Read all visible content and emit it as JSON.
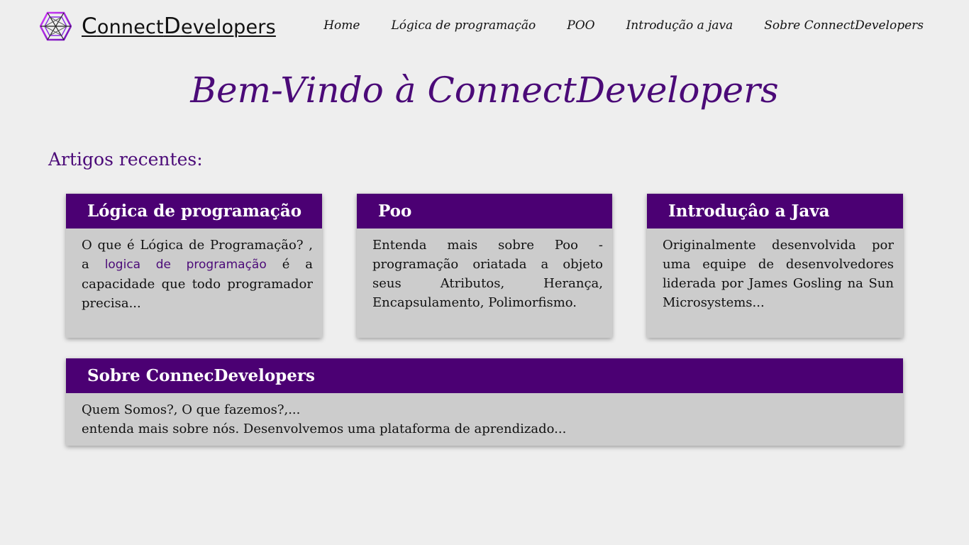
{
  "header": {
    "brand": {
      "c1": "C",
      "r1": "onnect",
      "c2": "D",
      "r2": "evelopers"
    },
    "nav": [
      {
        "label": "Home"
      },
      {
        "label": "Lógica de programação"
      },
      {
        "label": "POO"
      },
      {
        "label": "Introdução a java"
      },
      {
        "label": "Sobre ConnectDevelopers"
      }
    ]
  },
  "hero": {
    "title": "Bem-Vindo à ConnectDevelopers"
  },
  "recent": {
    "title": "Artigos recentes:",
    "cards": [
      {
        "title": "Lógica de programação",
        "before": "O que é Lógica de Programação? , a ",
        "link": "logica de programação",
        "after": " é a capacidade que todo programador precisa..."
      },
      {
        "title": "Poo",
        "body": "Entenda mais sobre Poo - programação oriatada a objeto seus Atributos, Herança, Encapsulamento, Polimorfismo."
      },
      {
        "title": "Introduçâo a Java",
        "body": "Originalmente desenvolvida por uma equipe de desenvolvedores liderada por James Gosling na Sun Microsystems..."
      }
    ]
  },
  "about": {
    "title": "Sobre ConnecDevelopers",
    "line1": "Quem Somos?, O que fazemos?,...",
    "line2": "entenda mais sobre nós. Desenvolvemos uma plataforma de aprendizado..."
  },
  "colors": {
    "accent": "#4b0a78",
    "card_header": "#4b0073",
    "card_body": "#cccccc",
    "background": "#eeeeee"
  },
  "icons": {
    "logo": "hexagon-network-logo-icon"
  }
}
